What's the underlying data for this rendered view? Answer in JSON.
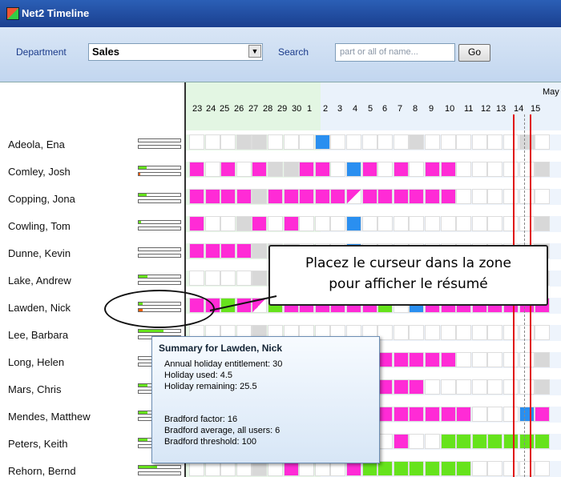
{
  "window": {
    "title": "Net2 Timeline"
  },
  "toolbar": {
    "department_label": "Department",
    "department_value": "Sales",
    "search_label": "Search",
    "search_placeholder": "part or all of name...",
    "go_label": "Go"
  },
  "timeline": {
    "month": "May",
    "days": [
      "23",
      "24",
      "25",
      "26",
      "27",
      "28",
      "29",
      "30",
      "1",
      "2",
      "3",
      "4",
      "5",
      "6",
      "7",
      "8",
      "9",
      "10",
      "11",
      "12",
      "13",
      "14",
      "15"
    ]
  },
  "people": [
    {
      "name": "Adeola, Ena"
    },
    {
      "name": "Comley, Josh"
    },
    {
      "name": "Copping, Jona"
    },
    {
      "name": "Cowling, Tom"
    },
    {
      "name": "Dunne, Kevin"
    },
    {
      "name": "Lake, Andrew"
    },
    {
      "name": "Lawden, Nick"
    },
    {
      "name": "Lee, Barbara"
    },
    {
      "name": "Long, Helen"
    },
    {
      "name": "Mars, Chris"
    },
    {
      "name": "Mendes, Matthew"
    },
    {
      "name": "Peters, Keith"
    },
    {
      "name": "Rehorn, Bernd"
    }
  ],
  "callout": {
    "line1": "Placez le curseur dans la zone",
    "line2": "pour afficher le résumé"
  },
  "summary": {
    "title": "Summary for Lawden, Nick",
    "entitlement": "Annual holiday entitlement: 30",
    "used": "Holiday used: 4.5",
    "remaining": "Holiday remaining: 25.5",
    "bradford": "Bradford factor: 16",
    "bradford_avg": "Bradford average, all users: 6",
    "bradford_threshold": "Bradford threshold: 100"
  },
  "colors": {
    "holiday": "#ff2bd6",
    "absence": "#2a8ff0",
    "green": "#66e31c",
    "weekend": "#d8d8d8",
    "today": "#e01010"
  }
}
